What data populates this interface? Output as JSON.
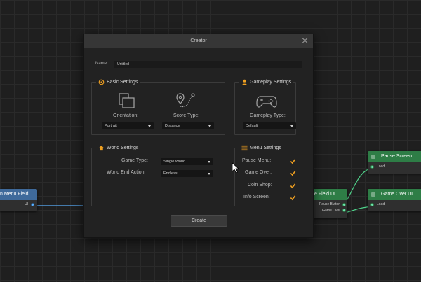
{
  "dialog": {
    "title": "Creator",
    "name_label": "Name:",
    "name_value": "Untitled",
    "create_label": "Create"
  },
  "basic_settings": {
    "title": "Basic Settings",
    "orientation_label": "Orientation:",
    "orientation_value": "Portrait",
    "score_type_label": "Score Type:",
    "score_type_value": "Distance"
  },
  "gameplay_settings": {
    "title": "Gameplay Settings",
    "gameplay_type_label": "Gameplay Type:",
    "gameplay_type_value": "Default"
  },
  "world_settings": {
    "title": "World Settings",
    "game_type_label": "Game Type:",
    "game_type_value": "Single World",
    "world_end_action_label": "World End Action:",
    "world_end_action_value": "Endless"
  },
  "menu_settings": {
    "title": "Menu Settings",
    "items": [
      {
        "label": "Pause Menu:",
        "checked": true
      },
      {
        "label": "Game Over:",
        "checked": true
      },
      {
        "label": "Coin Shop:",
        "checked": true
      },
      {
        "label": "Info Screen:",
        "checked": true
      }
    ]
  },
  "graph": {
    "main_menu_node": {
      "title": "n Menu Field",
      "port_label": "UI"
    },
    "field_ui_node": {
      "title": "e Field UI",
      "ports": [
        "Pause Button",
        "Game Over"
      ]
    },
    "pause_screen_node": {
      "title": "Pause Screen",
      "port_label": "Load"
    },
    "game_over_ui_node": {
      "title": "Game Over UI",
      "port_label": "Load"
    }
  },
  "colors": {
    "accent": "#f0a020",
    "node_green": "#2e7d46",
    "node_blue": "#3f6a9b",
    "wire_green": "#4fd28a",
    "wire_blue": "#5ab0ff"
  }
}
